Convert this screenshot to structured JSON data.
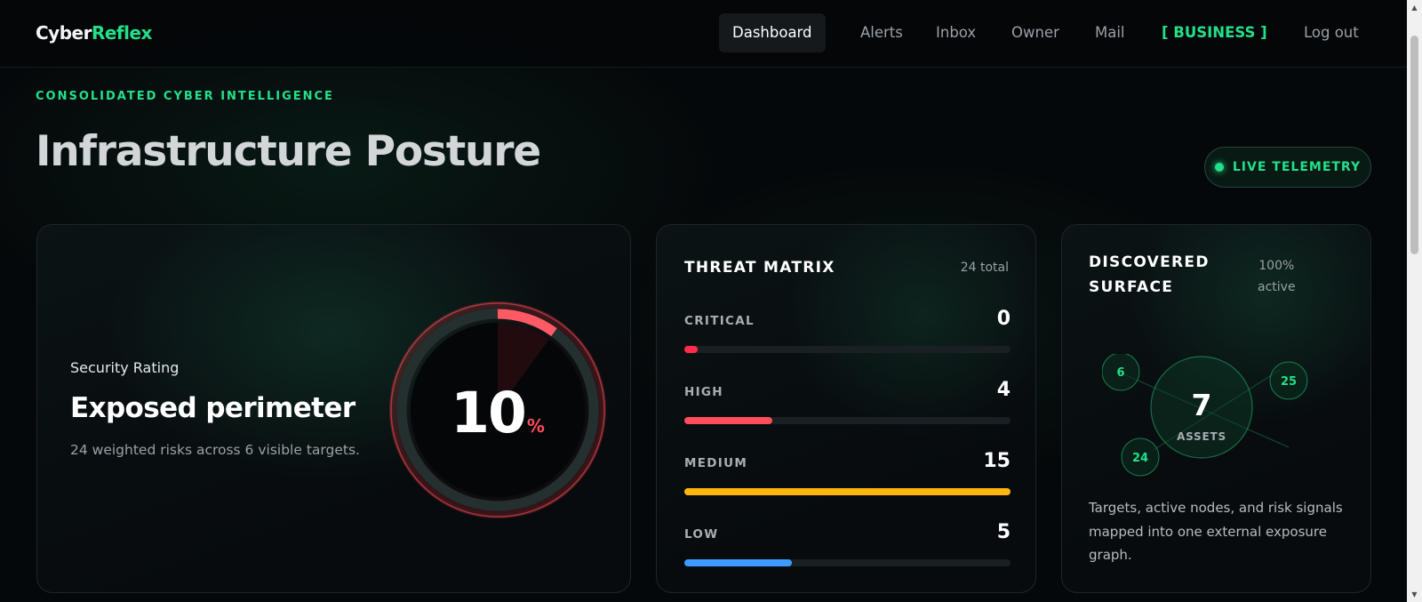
{
  "brand": {
    "part1": "Cyber",
    "part2": "Reflex"
  },
  "nav": {
    "items": [
      "Dashboard",
      "Alerts",
      "Inbox",
      "Owner",
      "Mail",
      "[ BUSINESS ]",
      "Log out"
    ],
    "active": "Dashboard"
  },
  "header": {
    "eyebrow": "CONSOLIDATED CYBER INTELLIGENCE",
    "title": "Infrastructure Posture",
    "live_badge": "LIVE TELEMETRY"
  },
  "rating": {
    "label": "Security Rating",
    "status": "Exposed perimeter",
    "description": "24 weighted risks across 6 visible targets.",
    "value": "10",
    "unit": "%",
    "fraction": 0.1
  },
  "threat_matrix": {
    "title": "THREAT MATRIX",
    "total_label": "24 total",
    "levels": [
      {
        "label": "CRITICAL",
        "count": "0",
        "fill": 0.04,
        "color": "#ff2d4b"
      },
      {
        "label": "HIGH",
        "count": "4",
        "fill": 0.27,
        "color": "#ff4d5a"
      },
      {
        "label": "MEDIUM",
        "count": "15",
        "fill": 1.0,
        "color": "#ffb60f"
      },
      {
        "label": "LOW",
        "count": "5",
        "fill": 0.33,
        "color": "#3b9bff"
      }
    ]
  },
  "surface": {
    "title_line1": "DISCOVERED",
    "title_line2": "SURFACE",
    "meta_line1": "100%",
    "meta_line2": "active",
    "center_value": "7",
    "center_label": "ASSETS",
    "nodes": [
      "6",
      "25",
      "24"
    ],
    "description": "Targets, active nodes, and risk signals mapped into one external exposure graph."
  },
  "colors": {
    "accent": "#22e08a",
    "danger": "#ff4d5a",
    "warning": "#ffb60f",
    "info": "#3b9bff",
    "background": "#05080a"
  }
}
